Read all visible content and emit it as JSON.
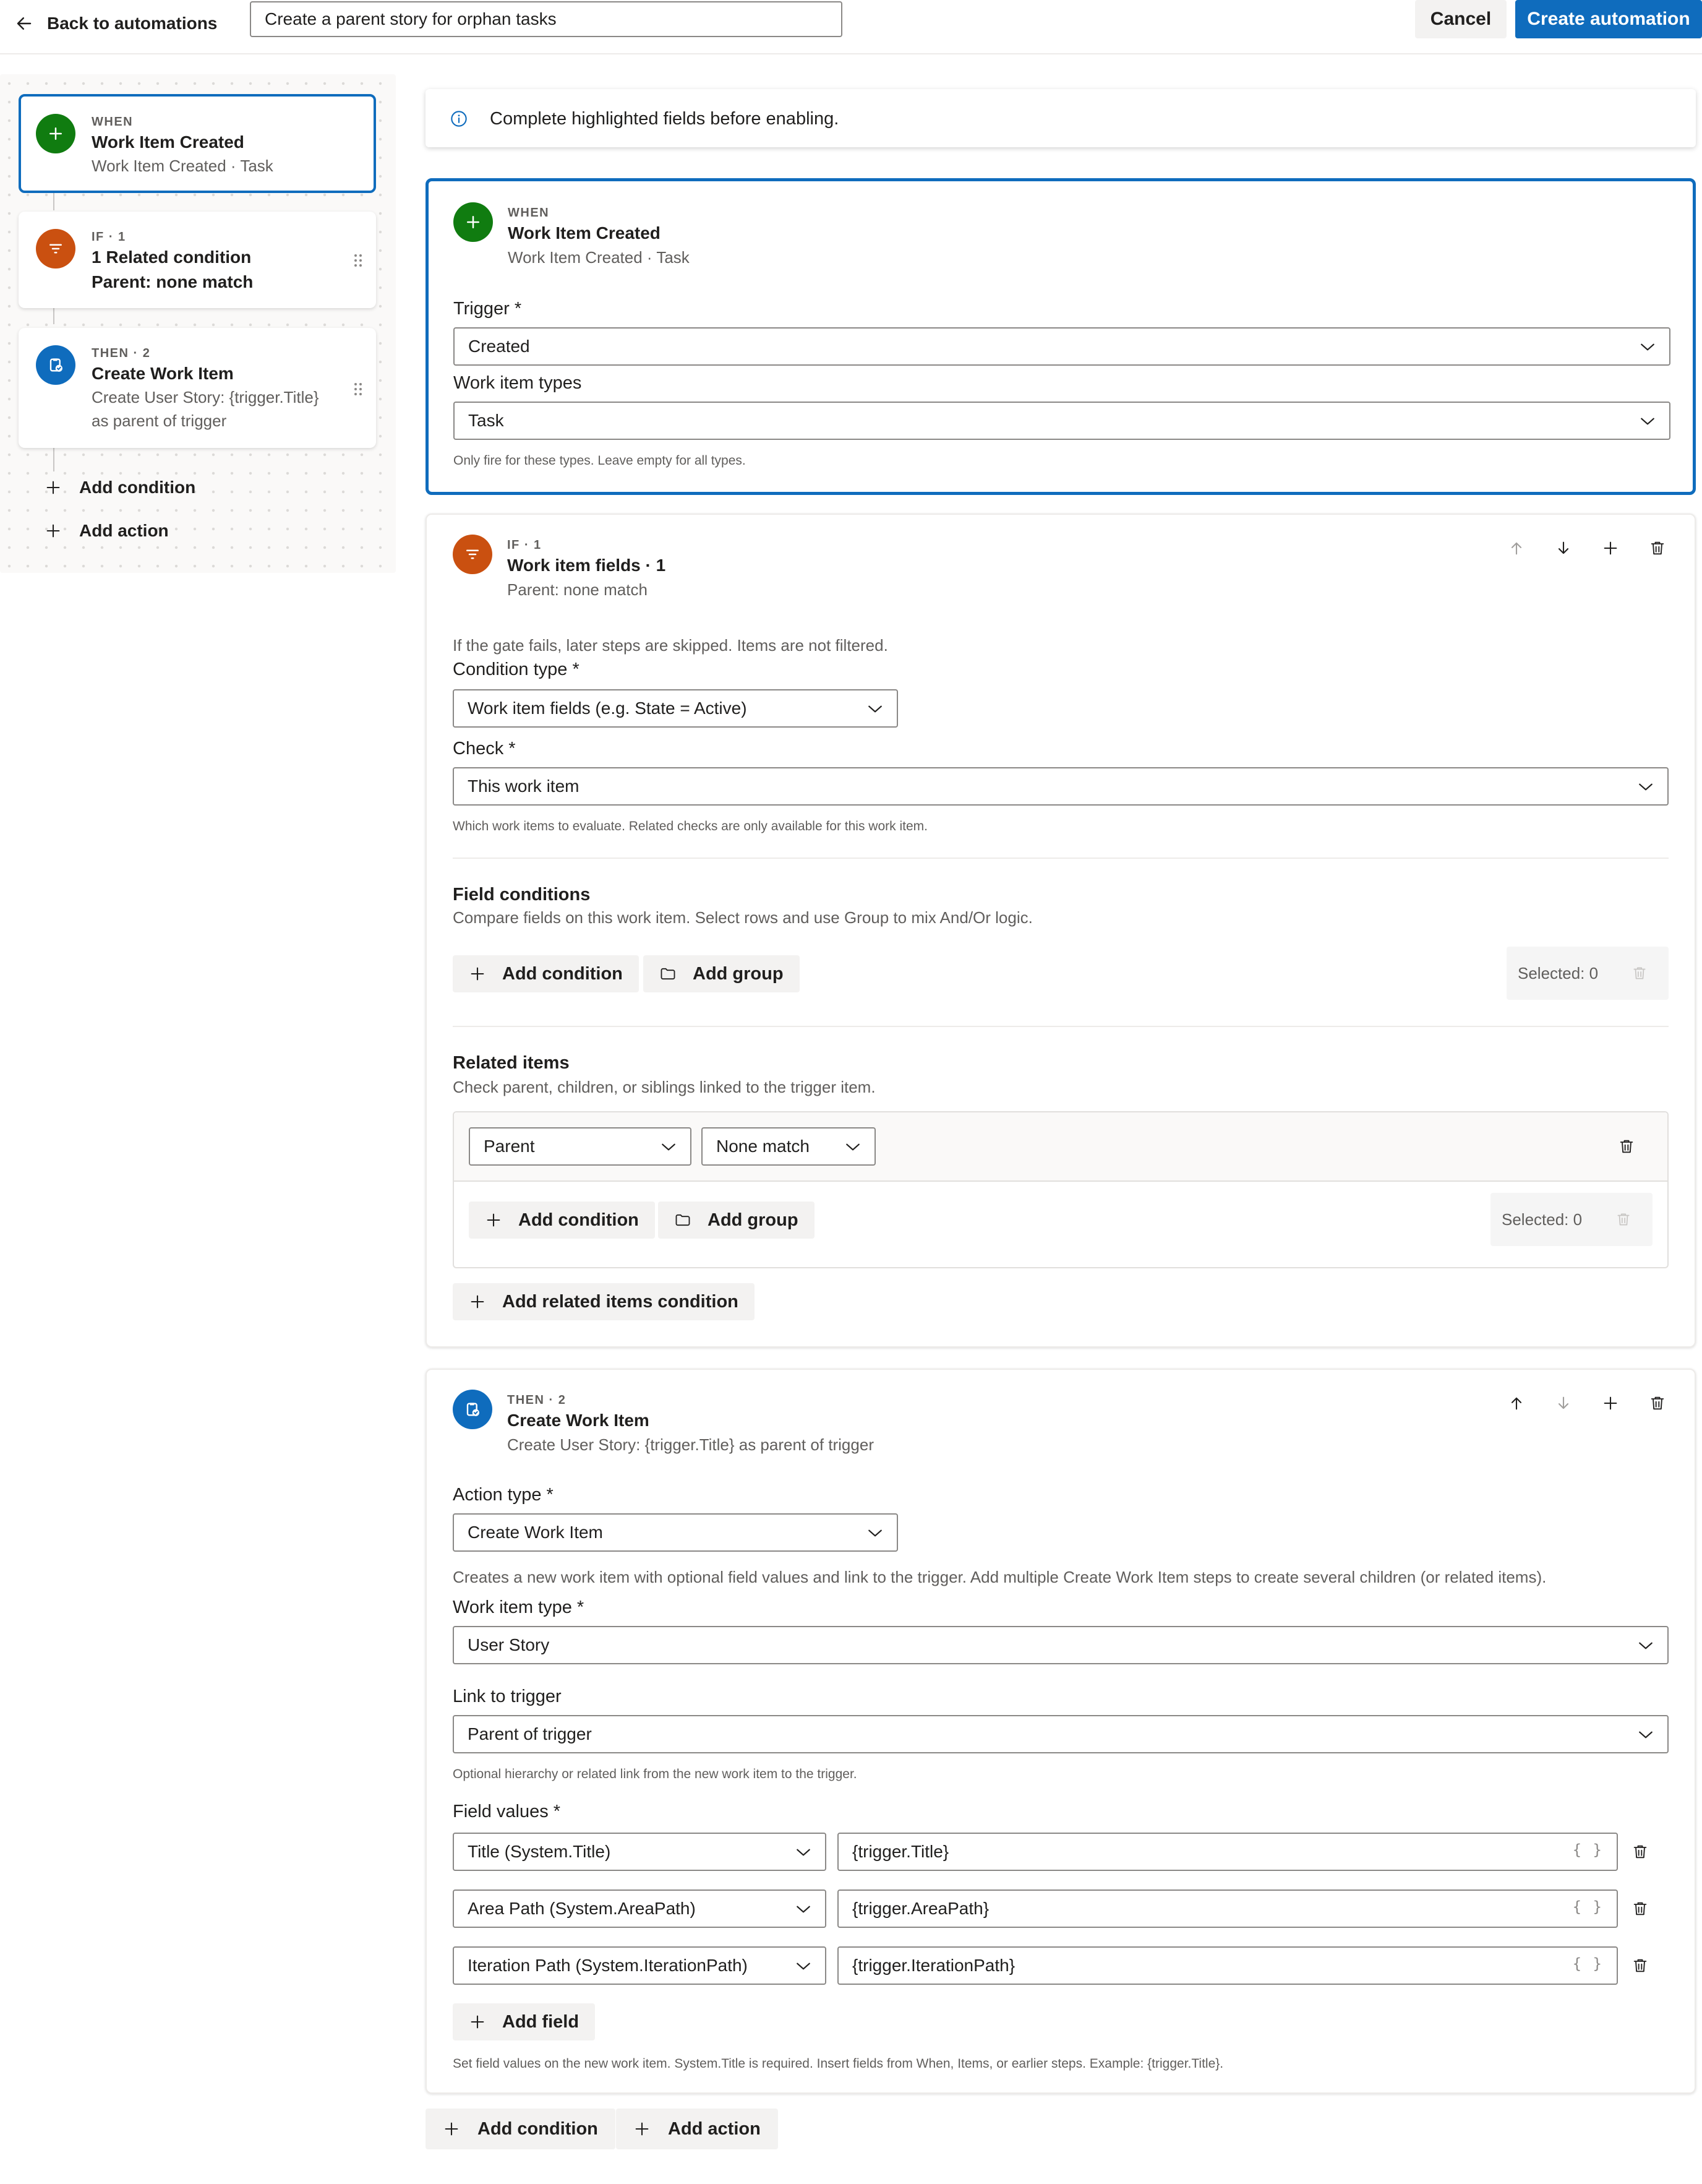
{
  "topbar": {
    "back_label": "Back to automations",
    "automation_name": "Create a parent story for orphan tasks",
    "cancel_label": "Cancel",
    "create_label": "Create automation"
  },
  "colors": {
    "accent": "#0f6cbd",
    "trigger_green": "#107c10",
    "condition_orange": "#ca5010",
    "action_blue": "#0f6cbd"
  },
  "rail": {
    "when": {
      "tag": "WHEN",
      "title": "Work Item Created",
      "subtitle": "Work Item Created · Task",
      "icon": "plus-icon"
    },
    "condition": {
      "tag": "IF · 1",
      "title": "1 Related condition",
      "subtitle": "Parent: none match",
      "icon": "filter-icon"
    },
    "action": {
      "tag": "THEN · 2",
      "title": "Create Work Item",
      "subtitle_line1": "Create User Story: {trigger.Title}",
      "subtitle_line2": "as parent of trigger",
      "icon": "work-item-icon"
    },
    "add_condition_label": "Add condition",
    "add_action_label": "Add action"
  },
  "info": {
    "message": "Complete highlighted fields before enabling."
  },
  "when_card": {
    "tag": "WHEN",
    "title": "Work Item Created",
    "subtitle": "Work Item Created · Task",
    "trigger_label": "Trigger *",
    "trigger_value": "Created",
    "types_label": "Work item types",
    "types_value": "Task",
    "types_hint": "Only fire for these types. Leave empty for all types."
  },
  "if_card": {
    "tag": "IF · 1",
    "title": "Work item fields · 1",
    "subtitle": "Parent: none match",
    "gate_note": "If the gate fails, later steps are skipped. Items are not filtered.",
    "condition_type_label": "Condition type *",
    "condition_type_value": "Work item fields (e.g. State = Active)",
    "check_label": "Check *",
    "check_value": "This work item",
    "check_hint": "Which work items to evaluate. Related checks are only available for this work item.",
    "field_conditions_title": "Field conditions",
    "field_conditions_desc": "Compare fields on this work item. Select rows and use Group to mix And/Or logic.",
    "add_condition_label": "Add condition",
    "add_group_label": "Add group",
    "selected_label": "Selected: 0",
    "related_title": "Related items",
    "related_desc": "Check parent, children, or siblings linked to the trigger item.",
    "relation_value": "Parent",
    "match_value": "None match",
    "related_add_condition_label": "Add condition",
    "related_add_group_label": "Add group",
    "related_selected_label": "Selected: 0",
    "add_related_label": "Add related items condition"
  },
  "then_card": {
    "tag": "THEN · 2",
    "title": "Create Work Item",
    "subtitle": "Create User Story: {trigger.Title} as parent of trigger",
    "action_type_label": "Action type *",
    "action_type_value": "Create Work Item",
    "action_desc": "Creates a new work item with optional field values and link to the trigger. Add multiple Create Work Item steps to create several children (or related items).",
    "wit_label": "Work item type *",
    "wit_value": "User Story",
    "link_label": "Link to trigger",
    "link_value": "Parent of trigger",
    "link_hint": "Optional hierarchy or related link from the new work item to the trigger.",
    "field_values_label": "Field values *",
    "field_rows": [
      {
        "field": "Title (System.Title)",
        "value": "{trigger.Title}"
      },
      {
        "field": "Area Path (System.AreaPath)",
        "value": "{trigger.AreaPath}"
      },
      {
        "field": "Iteration Path (System.IterationPath)",
        "value": "{trigger.IterationPath}"
      }
    ],
    "braces_glyph": "{ }",
    "add_field_label": "Add field",
    "field_values_hint": "Set field values on the new work item. System.Title is required. Insert fields from When, Items, or earlier steps. Example: {trigger.Title}."
  },
  "bottom": {
    "add_condition_label": "Add condition",
    "add_action_label": "Add action"
  }
}
